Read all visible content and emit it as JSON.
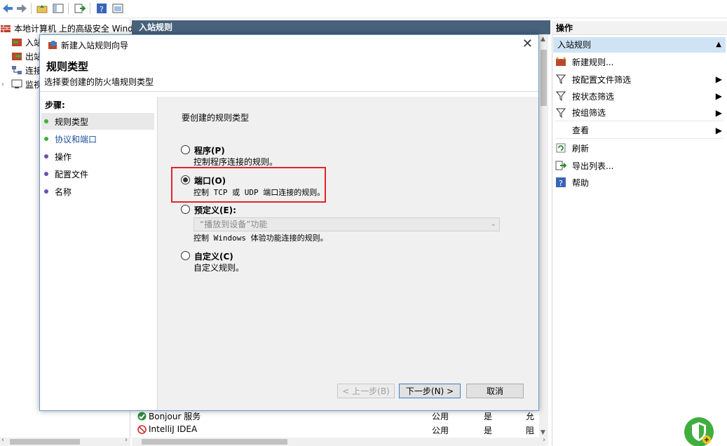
{
  "tree": {
    "root": "本地计算机 上的高级安全 Wind",
    "items": [
      "入站",
      "出站",
      "连接",
      "监视"
    ]
  },
  "center": {
    "header": "入站规则",
    "rows": [
      {
        "name": "Bonjour 服务",
        "profile": "公用",
        "enabled": "是",
        "action": "允"
      },
      {
        "name": "IntelliJ IDEA",
        "profile": "公用",
        "enabled": "是",
        "action": "阻"
      }
    ]
  },
  "actions": {
    "title": "操作",
    "section": "入站规则",
    "items": [
      {
        "label": "新建规则...",
        "icon": "new-rule-icon"
      },
      {
        "label": "按配置文件筛选",
        "icon": "filter-icon"
      },
      {
        "label": "按状态筛选",
        "icon": "filter-icon"
      },
      {
        "label": "按组筛选",
        "icon": "filter-icon"
      },
      {
        "label": "查看",
        "icon": ""
      },
      {
        "label": "刷新",
        "icon": "refresh-icon"
      },
      {
        "label": "导出列表...",
        "icon": "export-icon"
      },
      {
        "label": "帮助",
        "icon": "help-icon"
      }
    ]
  },
  "dialog": {
    "title": "新建入站规则向导",
    "heading": "规则类型",
    "subheading": "选择要创建的防火墙规则类型",
    "steps_title": "步骤:",
    "steps": [
      "规则类型",
      "协议和端口",
      "操作",
      "配置文件",
      "名称"
    ],
    "prompt": "要创建的规则类型",
    "options": [
      {
        "label": "程序(P)",
        "desc": "控制程序连接的规则。",
        "selected": false
      },
      {
        "label": "端口(O)",
        "desc": "控制 TCP 或 UDP 端口连接的规则。",
        "selected": true
      },
      {
        "label": "预定义(E):",
        "desc": "控制 Windows 体验功能连接的规则。",
        "selected": false
      },
      {
        "label": "自定义(C)",
        "desc": "自定义规则。",
        "selected": false
      }
    ],
    "predefined_value": "“播放到设备”功能",
    "buttons": {
      "back": "< 上一步(B)",
      "next": "下一步(N) >",
      "cancel": "取消"
    }
  },
  "colors": {
    "header_bg": "#48627d",
    "highlight": "#e3242b",
    "section_bg": "#cfe3f5"
  }
}
